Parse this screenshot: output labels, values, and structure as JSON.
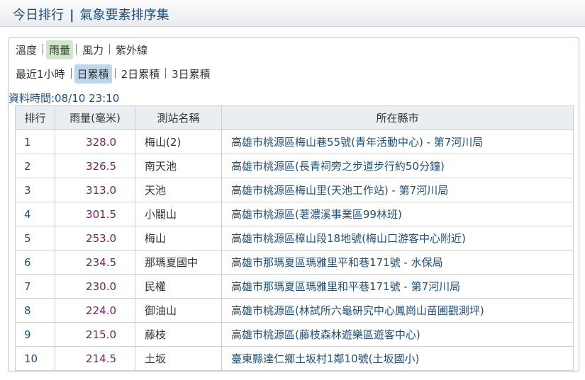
{
  "header": {
    "title": "今日排行",
    "subtitle": "氣象要素排序集"
  },
  "tabs_primary": [
    {
      "label": "溫度",
      "active": false
    },
    {
      "label": "雨量",
      "active": true
    },
    {
      "label": "風力",
      "active": false
    },
    {
      "label": "紫外線",
      "active": false
    }
  ],
  "tabs_secondary": [
    {
      "label": "最近1小時",
      "active": false
    },
    {
      "label": "日累積",
      "active": true
    },
    {
      "label": "2日累積",
      "active": false
    },
    {
      "label": "3日累積",
      "active": false
    }
  ],
  "data_time": "資料時間:08/10 23:10",
  "table": {
    "headers": [
      "排行",
      "雨量(毫米)",
      "測站名稱",
      "所在縣市"
    ],
    "rows": [
      {
        "rank": "1",
        "rain": "328.0",
        "station": "梅山(2)",
        "location": "高雄市桃源區梅山巷55號(青年活動中心) - 第7河川局"
      },
      {
        "rank": "2",
        "rain": "326.5",
        "station": "南天池",
        "location": "高雄市桃源區(長青祠旁之步道步行約50分鐘)"
      },
      {
        "rank": "3",
        "rain": "313.0",
        "station": "天池",
        "location": "高雄市桃源區梅山里(天池工作站) - 第7河川局"
      },
      {
        "rank": "4",
        "rain": "301.5",
        "station": "小關山",
        "location": "高雄市桃源區(荖濃溪事業區99林班)"
      },
      {
        "rank": "5",
        "rain": "253.0",
        "station": "梅山",
        "location": "高雄市桃源區樟山段18地號(梅山口游客中心附近)"
      },
      {
        "rank": "6",
        "rain": "234.5",
        "station": "那瑪夏國中",
        "location": "高雄市那瑪夏區瑪雅里平和巷171號 - 水保局"
      },
      {
        "rank": "7",
        "rain": "230.0",
        "station": "民權",
        "location": "高雄市那瑪夏區瑪雅里和平巷171號 - 第7河川局"
      },
      {
        "rank": "8",
        "rain": "224.0",
        "station": "御油山",
        "location": "高雄市桃源區(林試所六龜研究中心鳳崗山苗圃觀測坪)"
      },
      {
        "rank": "9",
        "rain": "215.0",
        "station": "藤枝",
        "location": "高雄市桃源區(藤枝森林遊樂區遊客中心)"
      },
      {
        "rank": "10",
        "rain": "214.5",
        "station": "土坂",
        "location": "臺東縣達仁鄉土坂村1鄰10號(土坂國小)"
      }
    ]
  }
}
